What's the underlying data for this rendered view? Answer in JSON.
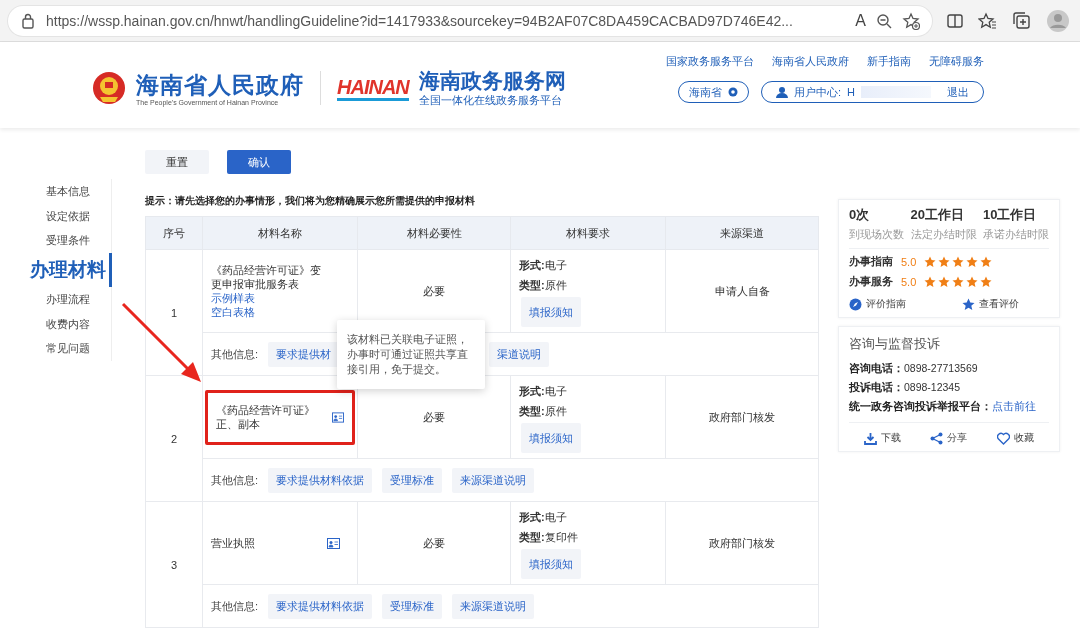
{
  "browser": {
    "url": "https://wssp.hainan.gov.cn/hnwt/handlingGuideline?id=1417933&sourcekey=94B2AF07C8DA459CACBAD97D746E42...",
    "read_aloud": "A"
  },
  "header": {
    "gov_title": "海南省人民政府",
    "gov_subtitle": "The People's Government of Hainan Province",
    "site_logo": "HAINAN",
    "site_title": "海南政务服务网",
    "site_subtitle": "全国一体化在线政务服务平台",
    "top_links": [
      "国家政务服务平台",
      "海南省人民政府",
      "新手指南",
      "无障碍服务"
    ],
    "region": "海南省",
    "user_label": "用户中心:",
    "user_name": "H",
    "logout": "退出"
  },
  "actions": [
    {
      "label": "重置",
      "kind": "secondary"
    },
    {
      "label": "确认",
      "kind": "primary"
    }
  ],
  "nav": [
    {
      "label": "基本信息",
      "selected": false
    },
    {
      "label": "设定依据",
      "selected": false
    },
    {
      "label": "受理条件",
      "selected": false
    },
    {
      "label": "办理材料",
      "selected": true
    },
    {
      "label": "办理流程",
      "selected": false
    },
    {
      "label": "收费内容",
      "selected": false
    },
    {
      "label": "常见问题",
      "selected": false
    }
  ],
  "hint": "提示：请先选择您的办事情形，我们将为您精确展示您所需提供的申报材料",
  "table": {
    "columns": [
      "序号",
      "材料名称",
      "材料必要性",
      "材料要求",
      "来源渠道"
    ],
    "rows": [
      {
        "index": "1",
        "name": "《药品经营许可证》变更申报审批服务表",
        "links": [
          "示例样表",
          "空白表格"
        ],
        "cert_icon": false,
        "highlighted": false,
        "necessity": "必要",
        "form_label": "形式:",
        "form": "电子",
        "type_label": "类型:",
        "type": "原件",
        "notice": "填报须知",
        "source": "申请人自备",
        "other_label": "其他信息:",
        "other_links": [
          "要求提供材",
          "渠道说明"
        ],
        "covered": true
      },
      {
        "index": "2",
        "name": "《药品经营许可证》正、副本",
        "links": [],
        "cert_icon": true,
        "highlighted": true,
        "tooltip": "该材料已关联电子证照，办事时可通过证照共享直接引用，免于提交。",
        "necessity": "必要",
        "form_label": "形式:",
        "form": "电子",
        "type_label": "类型:",
        "type": "原件",
        "notice": "填报须知",
        "source": "政府部门核发",
        "other_label": "其他信息:",
        "other_links": [
          "要求提供材料依据",
          "受理标准",
          "来源渠道说明"
        ],
        "covered": false
      },
      {
        "index": "3",
        "name": "营业执照",
        "links": [],
        "cert_icon": true,
        "highlighted": false,
        "necessity": "必要",
        "form_label": "形式:",
        "form": "电子",
        "type_label": "类型:",
        "type": "复印件",
        "notice": "填报须知",
        "source": "政府部门核发",
        "other_label": "其他信息:",
        "other_links": [
          "要求提供材料依据",
          "受理标准",
          "来源渠道说明"
        ],
        "covered": false
      }
    ]
  },
  "panel": {
    "stats": [
      {
        "value": "0次",
        "label": "到现场次数"
      },
      {
        "value": "20工作日",
        "label": "法定办结时限"
      },
      {
        "value": "10工作日",
        "label": "承诺办结时限"
      }
    ],
    "ratings": [
      {
        "label": "办事指南",
        "score": "5.0",
        "stars": 5
      },
      {
        "label": "办事服务",
        "score": "5.0",
        "stars": 5
      }
    ],
    "rating_actions": [
      {
        "label": "评价指南",
        "kind": "compass"
      },
      {
        "label": "查看评价",
        "kind": "star"
      }
    ],
    "contact": {
      "title": "咨询与监督投诉",
      "lines": [
        {
          "label": "咨询电话：",
          "value": "0898-27713569",
          "kind": "text"
        },
        {
          "label": "投诉电话：",
          "value": "0898-12345",
          "kind": "text"
        },
        {
          "label": "统一政务咨询投诉举报平台：",
          "value": "点击前往",
          "kind": "link"
        }
      ]
    },
    "footer_actions": [
      {
        "label": "下载",
        "kind": "download"
      },
      {
        "label": "分享",
        "kind": "share"
      },
      {
        "label": "收藏",
        "kind": "heart"
      }
    ]
  }
}
